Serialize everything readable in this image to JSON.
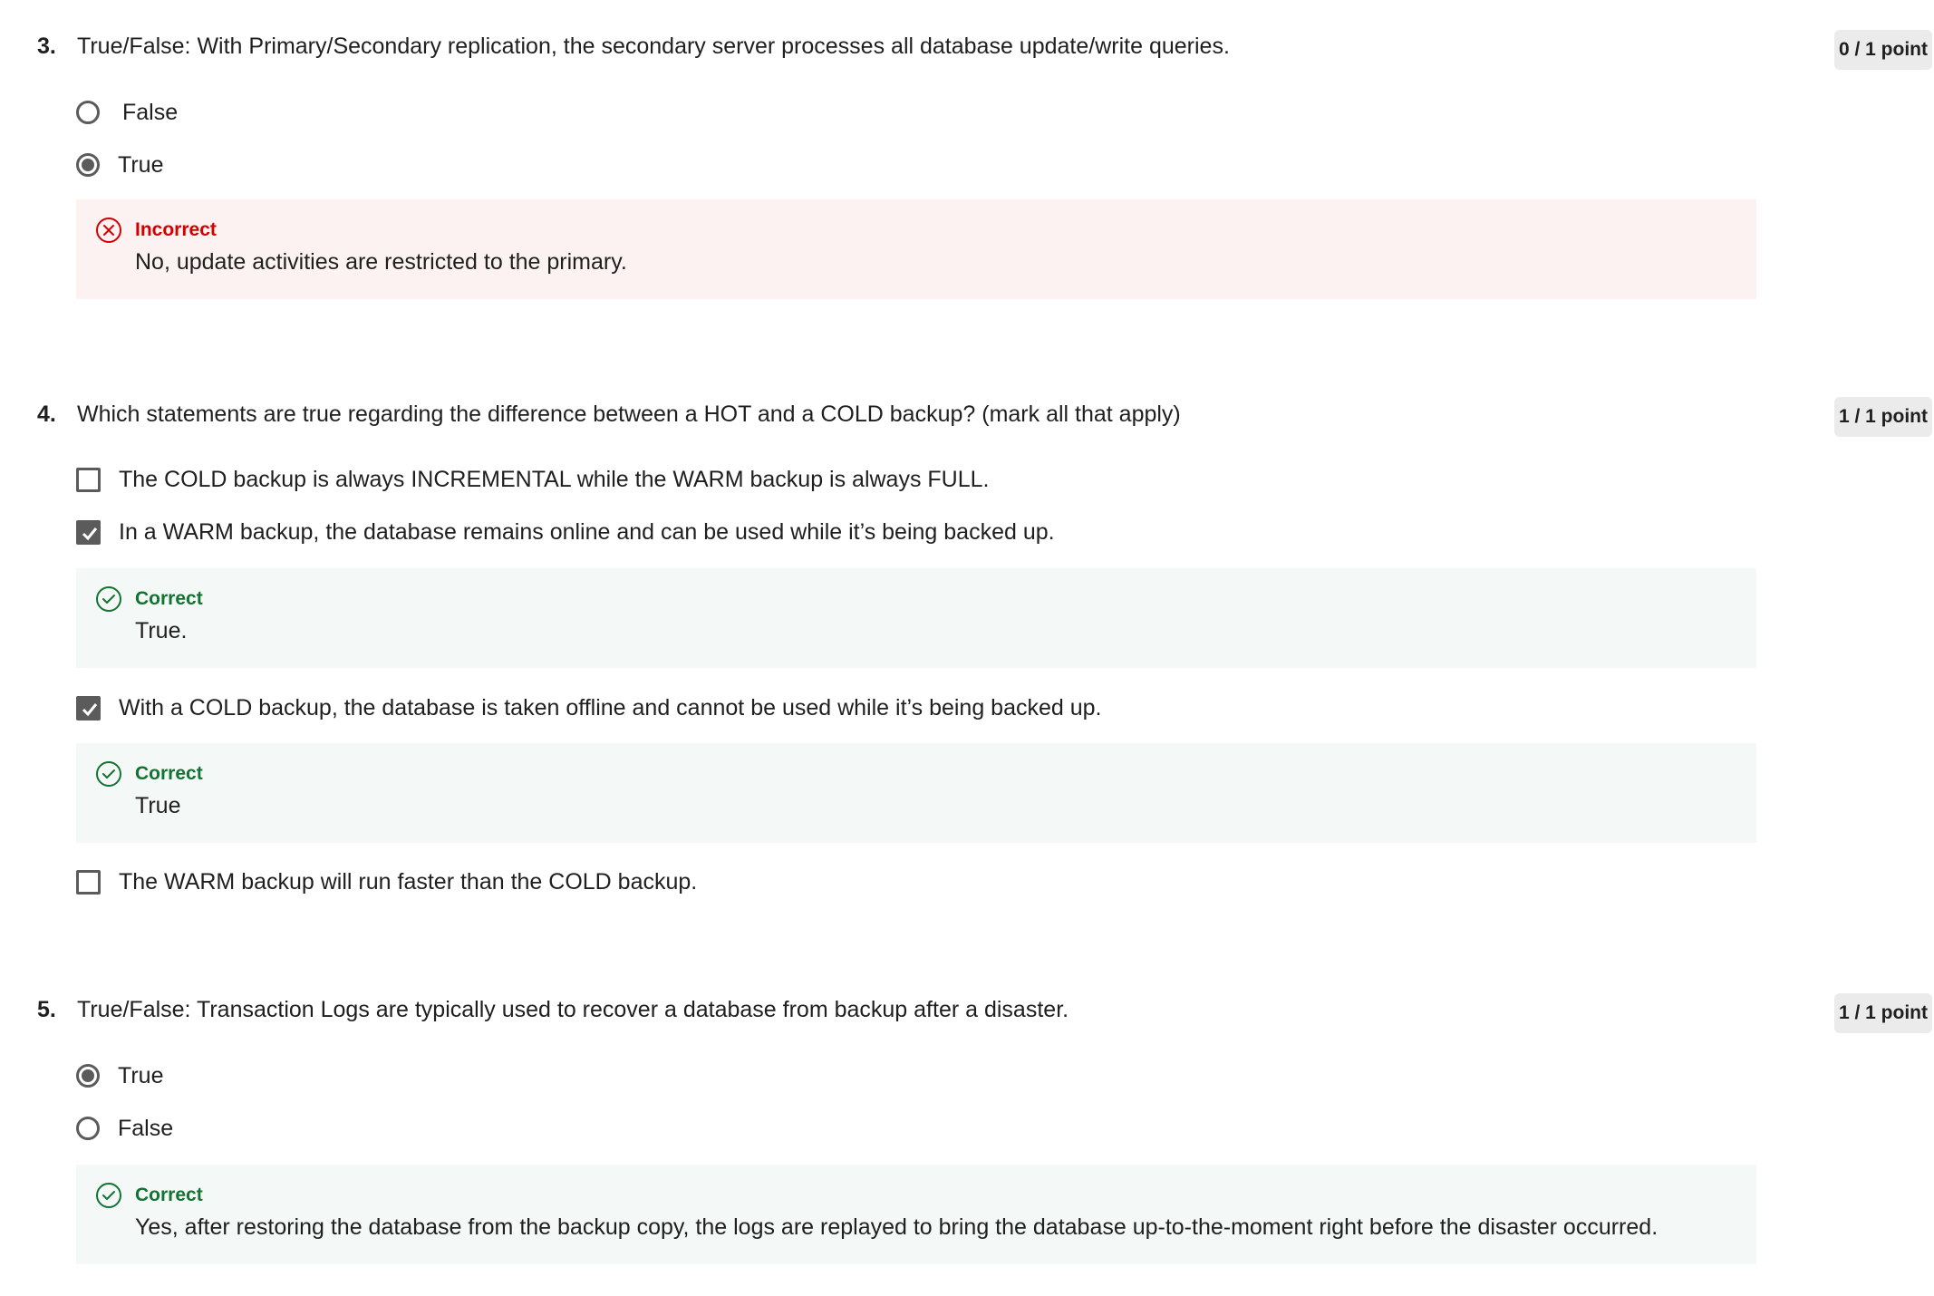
{
  "questions": [
    {
      "number": "3.",
      "text": "True/False: With Primary/Secondary replication, the secondary server processes all database update/write queries.",
      "points": "0 / 1 point",
      "options": [
        {
          "label": "False",
          "selected": false
        },
        {
          "label": "True",
          "selected": true
        }
      ],
      "feedback": {
        "status": "Incorrect",
        "text": "No, update activities are restricted to the primary."
      }
    },
    {
      "number": "4.",
      "text": "Which statements are true regarding the difference between a HOT and a COLD backup? (mark all that apply)",
      "points": "1 / 1 point",
      "options": [
        {
          "label": "The COLD backup is always INCREMENTAL while the WARM backup is always FULL.",
          "checked": false
        },
        {
          "label": "In a WARM backup, the database remains online and can be used while it’s being backed up.",
          "checked": true
        },
        {
          "label": "With a COLD backup, the database is taken offline and cannot be used while it’s being backed up.",
          "checked": true
        },
        {
          "label": "The WARM backup will run faster than the COLD backup.",
          "checked": false
        }
      ],
      "feedback": [
        {
          "status": "Correct",
          "text": "True."
        },
        {
          "status": "Correct",
          "text": "True"
        }
      ]
    },
    {
      "number": "5.",
      "text": "True/False: Transaction Logs are typically used to recover a database from backup after a disaster.",
      "points": "1 / 1 point",
      "options": [
        {
          "label": "True",
          "selected": true
        },
        {
          "label": "False",
          "selected": false
        }
      ],
      "feedback": {
        "status": "Correct",
        "text": "Yes, after restoring the database from the backup copy, the logs are replayed to bring the database up-to-the-moment right before the disaster occurred."
      }
    }
  ],
  "colors": {
    "incorrect_text": "#d30001",
    "incorrect_bg": "#fdf2f2",
    "correct_text": "#137333",
    "correct_bg": "#f4f8f6",
    "points_bg": "#ebebeb",
    "control_gray": "#5b5b5b"
  },
  "icons": {
    "incorrect": "x-circle-icon",
    "correct": "check-circle-icon"
  }
}
